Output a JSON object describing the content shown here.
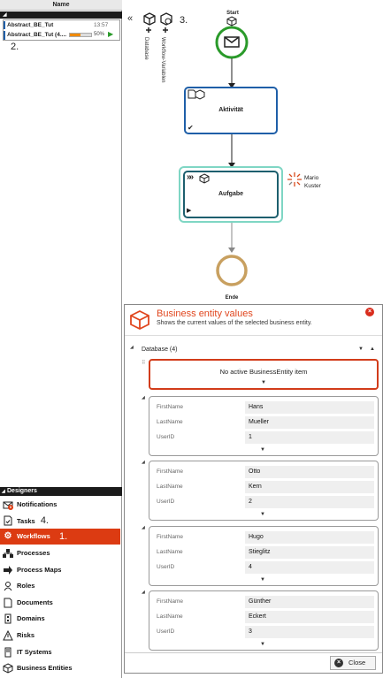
{
  "left_panel": {
    "column_header": "Name",
    "instances": [
      {
        "name": "Abstract_BE_Tut",
        "time": "13:57"
      },
      {
        "name": "Abstract_BE_Tut (4....",
        "progress_label": "50%",
        "progress": 0.5
      }
    ],
    "annotation_2": "2.",
    "designers_header": "Designers",
    "nav": [
      {
        "label": "Notifications",
        "icon": "envelope-icon",
        "badge": "0"
      },
      {
        "label": "Tasks",
        "icon": "tasks-icon",
        "annotation": "4."
      },
      {
        "label": "Workflows",
        "icon": "gear-icon",
        "annotation": "1.",
        "active": true
      },
      {
        "label": "Processes",
        "icon": "process-icon"
      },
      {
        "label": "Process Maps",
        "icon": "process-map-icon"
      },
      {
        "label": "Roles",
        "icon": "role-icon"
      },
      {
        "label": "Documents",
        "icon": "document-icon"
      },
      {
        "label": "Domains",
        "icon": "domain-icon"
      },
      {
        "label": "Risks",
        "icon": "warning-icon"
      },
      {
        "label": "IT Systems",
        "icon": "it-system-icon"
      },
      {
        "label": "Business Entities",
        "icon": "business-entity-icon"
      }
    ]
  },
  "diagram": {
    "toolbar_annotation": "3.",
    "toolbar_labels": [
      "Database",
      "Workflow-Variablen"
    ],
    "start_label": "Start",
    "activity_label": "Aktivität",
    "task_label": "Aufgabe",
    "assignee": [
      "Mario",
      "Kuster"
    ],
    "end_label": "Ende"
  },
  "dialog": {
    "title": "Business entity values",
    "subtitle": "Shows the current values of the selected business entity.",
    "section_label": "Database (4)",
    "no_active": "No active BusinessEntity item",
    "field_labels": [
      "FirstName",
      "LastName",
      "UserID"
    ],
    "records": [
      {
        "FirstName": "Hans",
        "LastName": "Mueller",
        "UserID": "1"
      },
      {
        "FirstName": "Otto",
        "LastName": "Kern",
        "UserID": "2"
      },
      {
        "FirstName": "Hugo",
        "LastName": "Stieglitz",
        "UserID": "4"
      },
      {
        "FirstName": "Günther",
        "LastName": "Eckert",
        "UserID": "3"
      }
    ],
    "close_label": "Close"
  },
  "colors": {
    "accent": "#dc3b12",
    "activity_border": "#1f5fa8",
    "task_border": "#2aa58c",
    "start_border": "#2a9a2a",
    "end_border": "#c8a060"
  }
}
